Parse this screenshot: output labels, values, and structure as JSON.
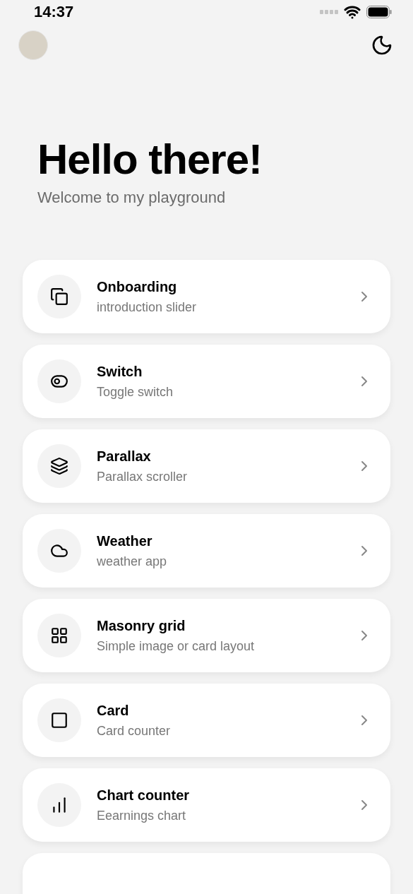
{
  "status_bar": {
    "time": "14:37"
  },
  "header": {
    "title": "Hello there!",
    "subtitle": "Welcome to my playground"
  },
  "items": [
    {
      "kind": "copy",
      "title": "Onboarding",
      "subtitle": "introduction slider"
    },
    {
      "kind": "toggle",
      "title": "Switch",
      "subtitle": "Toggle switch"
    },
    {
      "kind": "layers",
      "title": "Parallax",
      "subtitle": "Parallax scroller"
    },
    {
      "kind": "cloud",
      "title": "Weather",
      "subtitle": "weather app"
    },
    {
      "kind": "grid",
      "title": "Masonry grid",
      "subtitle": "Simple image or card layout"
    },
    {
      "kind": "square",
      "title": "Card",
      "subtitle": "Card counter"
    },
    {
      "kind": "chart",
      "title": "Chart counter",
      "subtitle": "Eearnings chart"
    }
  ]
}
